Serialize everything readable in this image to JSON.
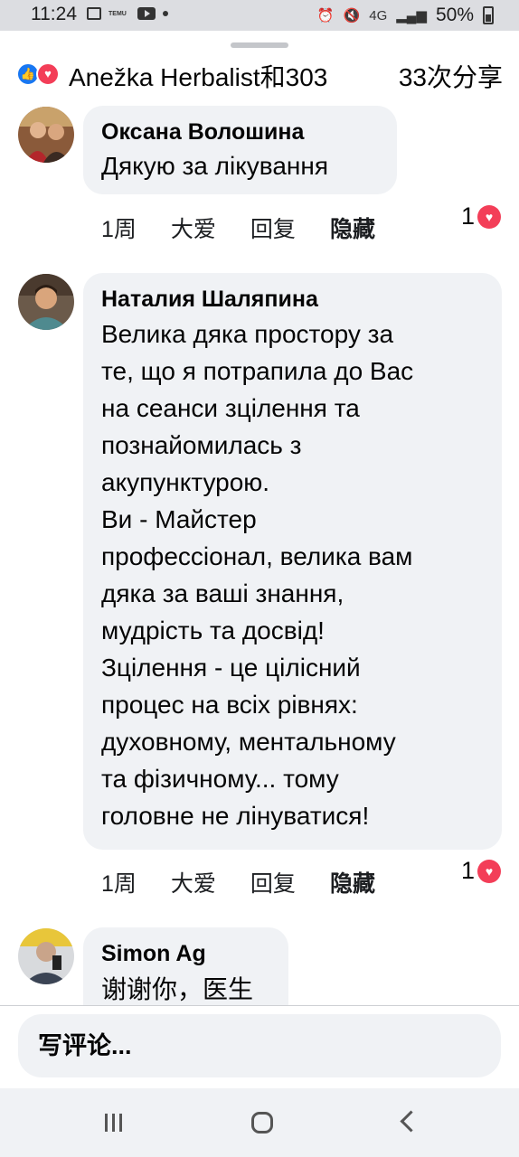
{
  "status_bar": {
    "time": "11:24",
    "notification_icons": [
      "image-icon",
      "temu-icon",
      "youtube-icon",
      "dot-icon"
    ],
    "temu_label": "TEMU",
    "network": "4G",
    "battery": "50%"
  },
  "header": {
    "reactors": "Anežka Herbalist和303",
    "shares": "33次分享"
  },
  "comments": [
    {
      "author": "Оксана Волошина",
      "text": "Дякую за лікування",
      "time": "1周",
      "react_label": "大爱",
      "reply_label": "回复",
      "hide_label": "隐藏",
      "like_count": "1"
    },
    {
      "author": "Наталия Шаляпина",
      "text_lines": [
        "Велика дяка простору за",
        "те, що я потрапила до Вас",
        "на сеанси зцілення та",
        "познайомилась з",
        "акупунктурою.",
        "Ви - Майстер",
        "профессіонал, велика вам",
        "дяка за ваші знання,",
        "мудрість та досвід!",
        "Зцілення - це цілісний",
        "процес на всіх рівнях:",
        "духовному, ментальному",
        "та фізичному... тому",
        "головне не лінуватися!"
      ],
      "time": "1周",
      "react_label": "大爱",
      "reply_label": "回复",
      "hide_label": "隐藏",
      "like_count": "1"
    },
    {
      "author": "Simon Ag",
      "text": "谢谢你，医生"
    }
  ],
  "composer": {
    "placeholder": "写评论..."
  },
  "colors": {
    "bubble_bg": "#f0f2f5",
    "like_blue": "#1877f2",
    "love_red": "#f33e58"
  }
}
